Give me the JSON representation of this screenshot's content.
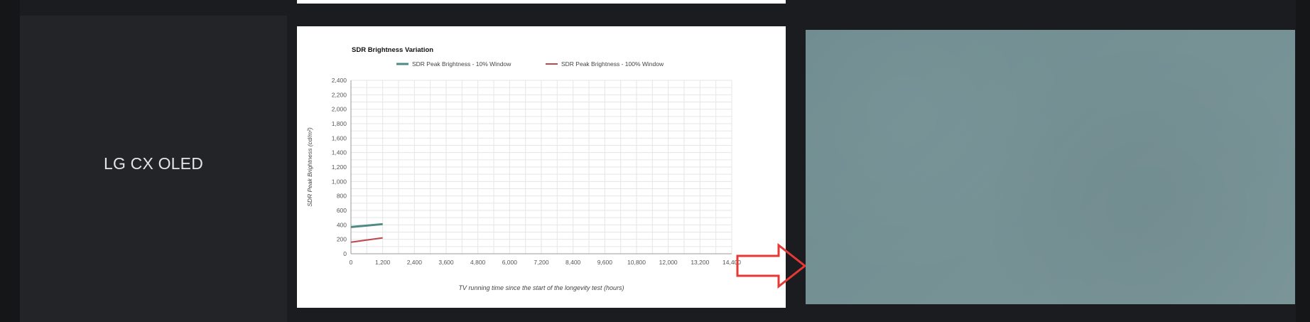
{
  "row": {
    "model_name": "LG CX OLED"
  },
  "colors": {
    "series_10": "#4f8a86",
    "series_100": "#c0474b",
    "arrow": "#e53935"
  },
  "chart_data": {
    "type": "line",
    "title": "SDR Brightness Variation",
    "xlabel": "TV running time since the start of the longevity test (hours)",
    "ylabel": "SDR Peak Brightness (cd/m²)",
    "xlim": [
      0,
      14400
    ],
    "ylim": [
      0,
      2400
    ],
    "x_ticks": [
      0,
      1200,
      2400,
      3600,
      4800,
      6000,
      7200,
      8400,
      9600,
      10800,
      12000,
      13200,
      14400
    ],
    "x_tick_labels": [
      "0",
      "1,200",
      "2,400",
      "3,600",
      "4,800",
      "6,000",
      "7,200",
      "8,400",
      "9,600",
      "10,800",
      "12,000",
      "13,200",
      "14,400"
    ],
    "y_ticks": [
      0,
      200,
      400,
      600,
      800,
      1000,
      1200,
      1400,
      1600,
      1800,
      2000,
      2200,
      2400
    ],
    "y_tick_labels": [
      "0",
      "200",
      "400",
      "600",
      "800",
      "1,000",
      "1,200",
      "1,400",
      "1,600",
      "1,800",
      "2,000",
      "2,200",
      "2,400"
    ],
    "grid": true,
    "legend_position": "top",
    "series": [
      {
        "name": "SDR Peak Brightness - 10% Window",
        "x": [
          0,
          1200
        ],
        "values": [
          370,
          410
        ]
      },
      {
        "name": "SDR Peak Brightness - 100% Window",
        "x": [
          0,
          1200
        ],
        "values": [
          160,
          220
        ]
      }
    ]
  }
}
